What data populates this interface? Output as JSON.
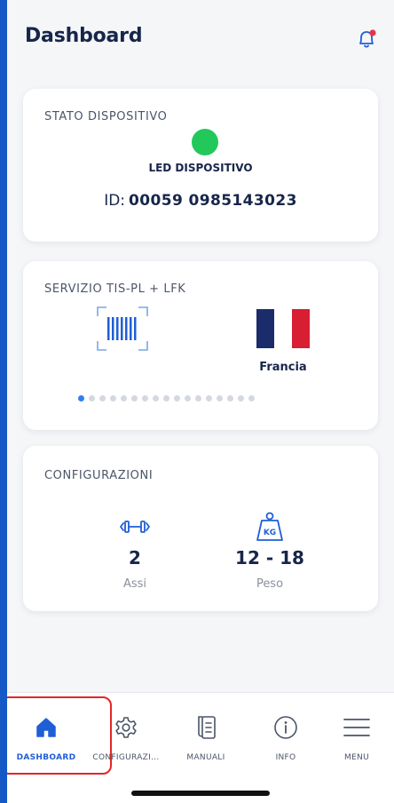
{
  "header": {
    "title": "Dashboard"
  },
  "device_status": {
    "title": "STATO DISPOSITIVO",
    "led_label": "LED DISPOSITIVO",
    "id_prefix": "ID:",
    "id_value": "00059 0985143023",
    "led_color": "#22c95a"
  },
  "service": {
    "title": "SERVIZIO TIS-PL + LFK",
    "country_label": "Francia",
    "carousel_active_index": 0,
    "carousel_count": 17
  },
  "configurations": {
    "title": "CONFIGURAZIONI",
    "axes": {
      "value": "2",
      "label": "Assi"
    },
    "weight": {
      "value": "12 - 18",
      "label": "Peso",
      "icon_text": "KG"
    }
  },
  "nav": {
    "items": [
      {
        "label": "DASHBOARD",
        "icon": "home-icon",
        "active": true
      },
      {
        "label": "CONFIGURAZI...",
        "icon": "gear-icon",
        "active": false
      },
      {
        "label": "MANUALI",
        "icon": "manual-icon",
        "active": false
      },
      {
        "label": "INFO",
        "icon": "info-icon",
        "active": false
      },
      {
        "label": "MENU",
        "icon": "menu-icon",
        "active": false
      }
    ]
  },
  "colors": {
    "accent": "#1f5fd6",
    "text_dark": "#17264a",
    "highlight": "#e32626",
    "flag_blue": "#1b2c6b",
    "flag_white": "#ffffff",
    "flag_red": "#d81e32"
  }
}
